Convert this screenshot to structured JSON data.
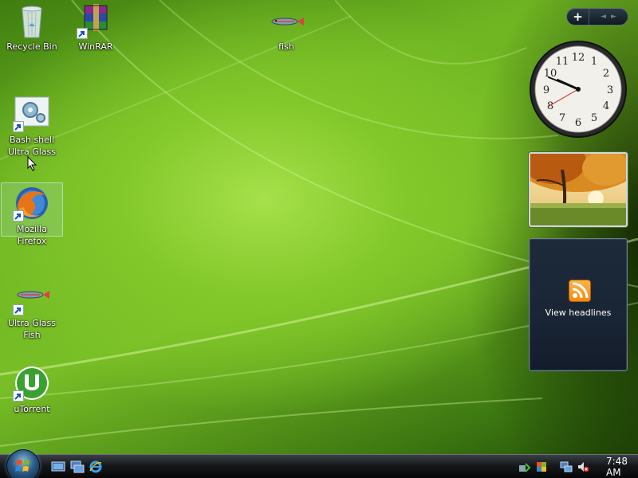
{
  "desktop": {
    "icons": [
      {
        "label": "Recycle Bin"
      },
      {
        "label": "WinRAR"
      },
      {
        "label": "fish"
      },
      {
        "label_line1": "Bash shell",
        "label_line2": "Ultra Glass"
      },
      {
        "label": "Mozilla Firefox"
      },
      {
        "label_line1": "Ultra Glass",
        "label_line2": "Fish"
      },
      {
        "label": "uTorrent"
      }
    ]
  },
  "sidebar": {
    "add_label": "+",
    "prev_label": "◄",
    "next_label": "►",
    "clock": {
      "hour": 9,
      "minute": 48,
      "second": 40
    },
    "feed": {
      "label": "View headlines"
    }
  },
  "taskbar": {
    "time": "7:48 AM"
  },
  "colors": {
    "accent": "#7ac126",
    "taskbar": "#16191c",
    "feed_bg": "#1d2a3a",
    "rss_orange": "#f08a10"
  }
}
